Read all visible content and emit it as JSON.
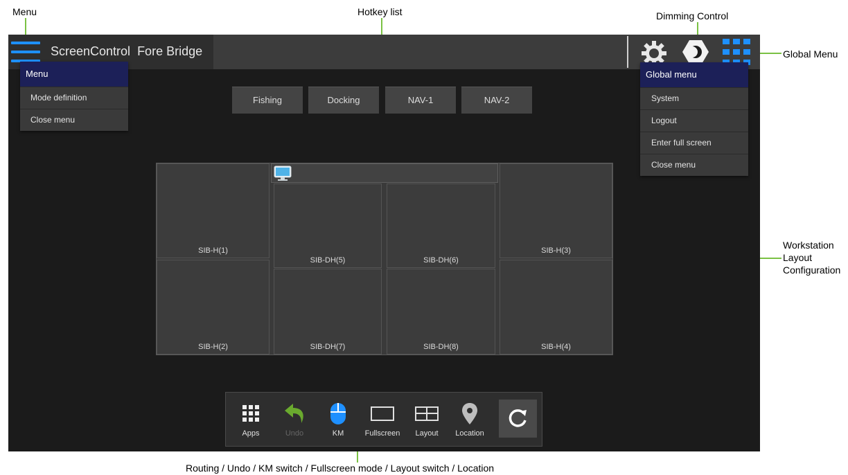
{
  "annotations": {
    "menu": "Menu",
    "hotkey_list": "Hotkey list",
    "dimming_control": "Dimming Control",
    "global_menu": "Global Menu",
    "workstation_lines": [
      "Workstation",
      "Layout",
      "Configuration"
    ],
    "bottom_caption": "Routing / Undo / KM switch / Fullscreen mode / Layout switch / Location"
  },
  "header": {
    "app_name": "ScreenControl",
    "location": "Fore Bridge"
  },
  "left_menu": {
    "title": "Menu",
    "items": [
      "Mode definition",
      "Close menu"
    ]
  },
  "global_menu": {
    "title": "Global menu",
    "items": [
      "System",
      "Logout",
      "Enter full screen",
      "Close menu"
    ]
  },
  "hotkeys": [
    "Fishing",
    "Docking",
    "NAV-1",
    "NAV-2"
  ],
  "workstation": {
    "screens": [
      "SIB-H(1)",
      "SIB-H(2)",
      "SIB-DH(5)",
      "SIB-DH(6)",
      "SIB-DH(7)",
      "SIB-DH(8)",
      "SIB-H(3)",
      "SIB-H(4)"
    ]
  },
  "toolbar": {
    "items": [
      {
        "label": "Apps",
        "icon": "apps-grid-icon"
      },
      {
        "label": "Undo",
        "icon": "undo-arrow-icon",
        "disabled": true
      },
      {
        "label": "KM",
        "icon": "mouse-icon"
      },
      {
        "label": "Fullscreen",
        "icon": "fullscreen-icon"
      },
      {
        "label": "Layout",
        "icon": "layout-icon"
      },
      {
        "label": "Location",
        "icon": "location-pin-icon"
      }
    ],
    "refresh_icon": "refresh-icon"
  },
  "colors": {
    "accent_blue": "#1e90ff",
    "annotation_green": "#7ac143",
    "menu_header": "#1c2058",
    "undo_green": "#6aaa2e"
  }
}
